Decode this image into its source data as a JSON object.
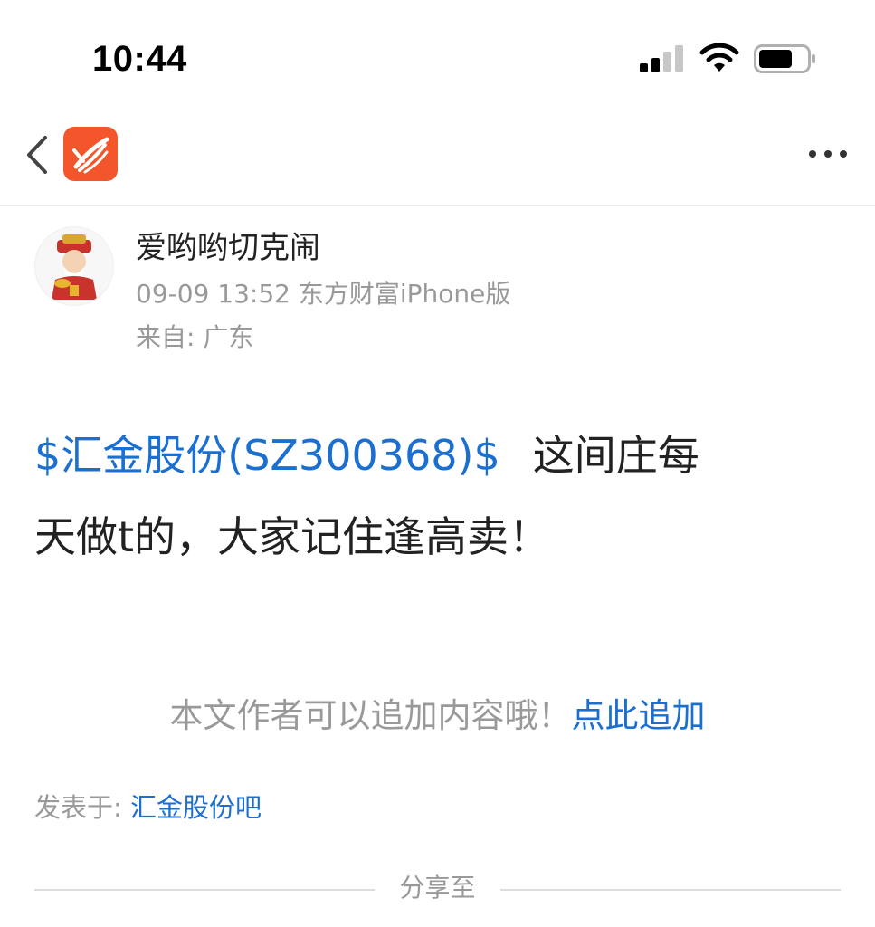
{
  "status_bar": {
    "time": "10:44"
  },
  "nav": {
    "back_icon": "chevron-left-icon",
    "logo_icon": "eastmoney-logo-icon",
    "more_icon": "more-dots-icon"
  },
  "post": {
    "author": "爱哟哟切克闹",
    "meta": "09-09 13:52 东方财富iPhone版",
    "location": "来自: 广东",
    "stock_tag": "$汇金股份(SZ300368)$",
    "body_line1": "这间庄每",
    "body_line2": "天做t的，大家记住逢高卖！"
  },
  "append": {
    "hint": "本文作者可以追加内容哦！",
    "link": "点此追加"
  },
  "posted_in": {
    "label": "发表于: ",
    "forum": "汇金股份吧"
  },
  "share": {
    "label": "分享至"
  },
  "colors": {
    "link_blue": "#1a6fd1",
    "muted_gray": "#999999",
    "brand_orange": "#f2562a"
  }
}
